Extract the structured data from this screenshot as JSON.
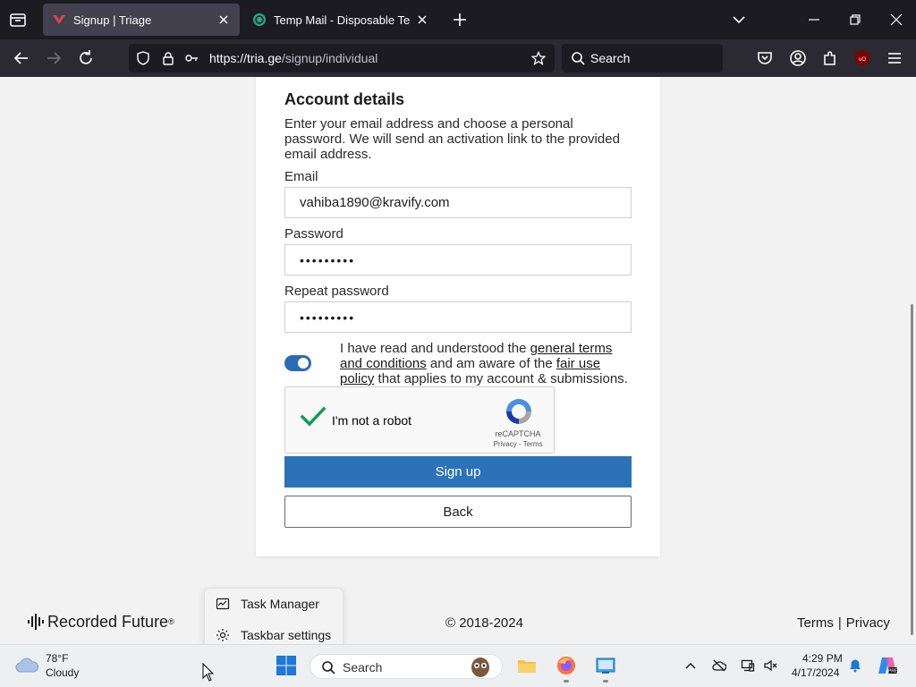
{
  "browser": {
    "tabs": [
      {
        "title": "Signup | Triage",
        "active": true
      },
      {
        "title": "Temp Mail - Disposable Tempo",
        "active": false
      }
    ],
    "url_host": "https://tria.ge",
    "url_path": "/signup/individual",
    "search_placeholder": "Search"
  },
  "form": {
    "section_title": "Account details",
    "intro": "Enter your email address and choose a personal password. We will send an activation link to the provided email address.",
    "email_label": "Email",
    "email_value": "vahiba1890@kravify.com",
    "password_label": "Password",
    "password_value": "•••••••••",
    "repeat_label": "Repeat password",
    "repeat_value": "•••••••••",
    "terms_part1": "I have read and understood the ",
    "terms_link1": "general terms and conditions",
    "terms_part2": " and am aware of the ",
    "terms_link2": "fair use policy",
    "terms_part3": " that applies to my account & submissions.",
    "terms_accepted": true,
    "captcha_label": "I'm not a robot",
    "captcha_brand": "reCAPTCHA",
    "captcha_links": "Privacy - Terms",
    "signup_label": "Sign up",
    "back_label": "Back"
  },
  "footer": {
    "logo_text": "Recorded Future",
    "logo_mark": "®",
    "copyright": "© 2018-2024",
    "terms": "Terms",
    "separator": "|",
    "privacy": "Privacy"
  },
  "context_menu": {
    "items": [
      "Task Manager",
      "Taskbar settings"
    ]
  },
  "taskbar": {
    "weather_temp": "78°F",
    "weather_cond": "Cloudy",
    "search_placeholder": "Search",
    "time": "4:29 PM",
    "date": "4/17/2024"
  },
  "colors": {
    "primary": "#2c72b8",
    "chrome_dark": "#1c1b22",
    "page_bg": "#f2f2f2"
  }
}
